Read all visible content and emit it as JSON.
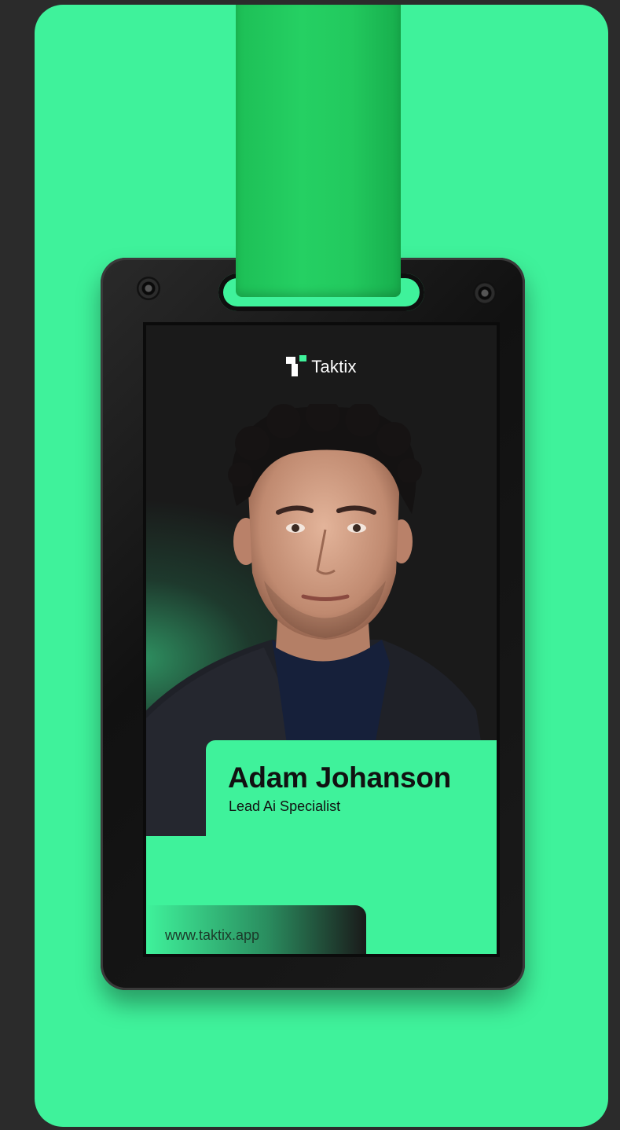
{
  "badge": {
    "brand": "Taktix",
    "name": "Adam Johanson",
    "role": "Lead Ai Specialist",
    "website": "www.taktix.app"
  },
  "colors": {
    "background": "#2b2b2b",
    "accent": "#3ff29b",
    "strap": "#22c95e",
    "card": "#1a1a1a"
  },
  "icons": [
    "taktix-logo-icon",
    "screw-icon"
  ]
}
